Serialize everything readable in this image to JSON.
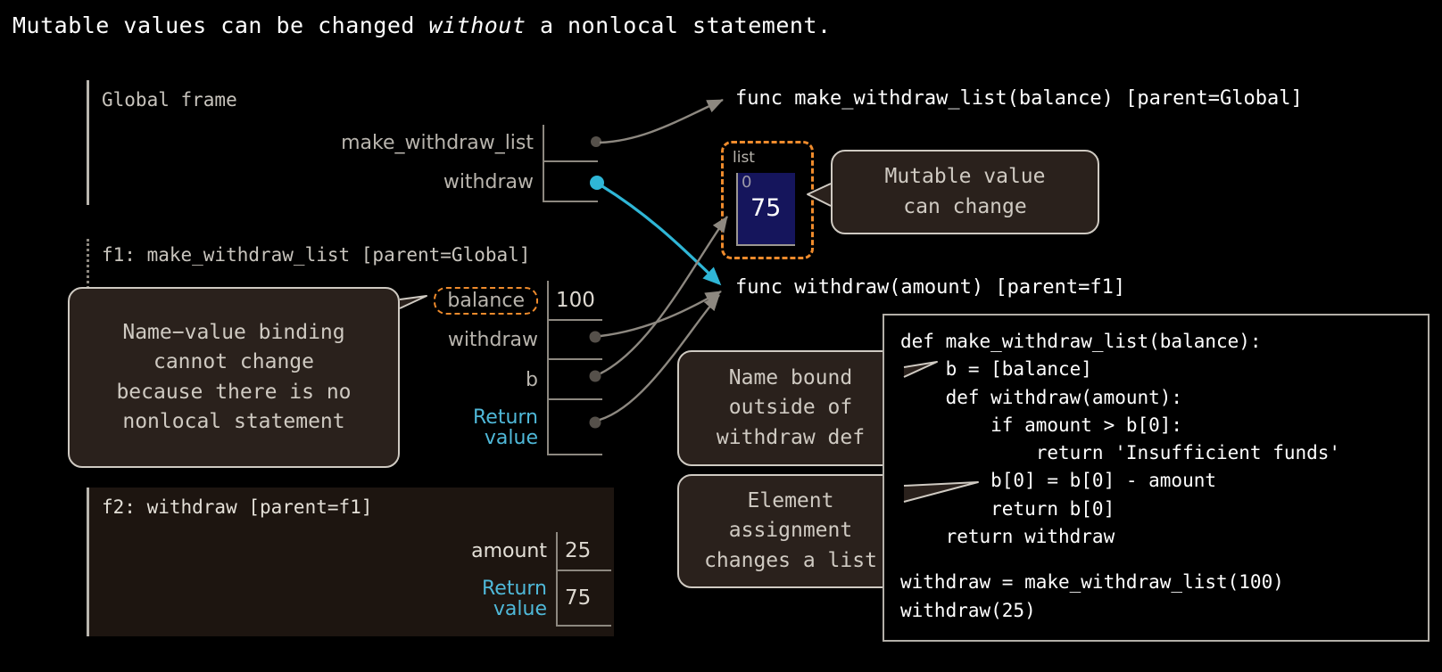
{
  "title": {
    "before": "Mutable values can be changed ",
    "emphasis": "without",
    "after": " a nonlocal statement."
  },
  "global_frame": {
    "label": "Global frame",
    "bindings": [
      {
        "name": "make_withdraw_list",
        "value": "",
        "dot": "gray"
      },
      {
        "name": "withdraw",
        "value": "",
        "dot": "cyan"
      }
    ]
  },
  "f1_frame": {
    "label": "f1: make_withdraw_list [parent=Global]",
    "bindings": [
      {
        "name": "balance",
        "value": "100",
        "highlighted": true
      },
      {
        "name": "withdraw",
        "value": "",
        "dot": "gray"
      },
      {
        "name": "b",
        "value": "",
        "dot": "gray"
      },
      {
        "name": "Return value",
        "value": "",
        "dot": "gray",
        "is_return": true
      }
    ]
  },
  "f2_frame": {
    "label": "f2: withdraw [parent=f1]",
    "bindings": [
      {
        "name": "amount",
        "value": "25"
      },
      {
        "name": "Return value",
        "value": "75",
        "is_return": true
      }
    ]
  },
  "function_values": [
    {
      "text": "func make_withdraw_list(balance) [parent=Global]"
    },
    {
      "text": "func withdraw(amount) [parent=f1]"
    }
  ],
  "list_object": {
    "type_label": "list",
    "index": "0",
    "value": "75"
  },
  "callouts": [
    {
      "id": "mutable-value",
      "text": "Mutable value\ncan change"
    },
    {
      "id": "name-value-binding",
      "text": "Name−value binding\ncannot change\nbecause there is no\nnonlocal statement"
    },
    {
      "id": "name-bound-outside",
      "text": "Name bound\noutside of\nwithdraw def"
    },
    {
      "id": "element-assignment",
      "text": "Element\nassignment\nchanges a list"
    }
  ],
  "code": {
    "lines_top": [
      "def make_withdraw_list(balance):",
      "    b = [balance]",
      "    def withdraw(amount):",
      "        if amount > b[0]:",
      "            return 'Insufficient funds'",
      "        b[0] = b[0] - amount",
      "        return b[0]",
      "    return withdraw"
    ],
    "lines_bottom": [
      "withdraw = make_withdraw_list(100)",
      "withdraw(25)"
    ]
  },
  "colors": {
    "background": "#000000",
    "highlight_dashed": "#ef8b2c",
    "accent_cyan": "#4fb8d8",
    "list_fill": "#15155c",
    "callout_fill": "#2a211c",
    "frame_line": "#b9b5ae",
    "f2_fill": "#1d1510"
  }
}
